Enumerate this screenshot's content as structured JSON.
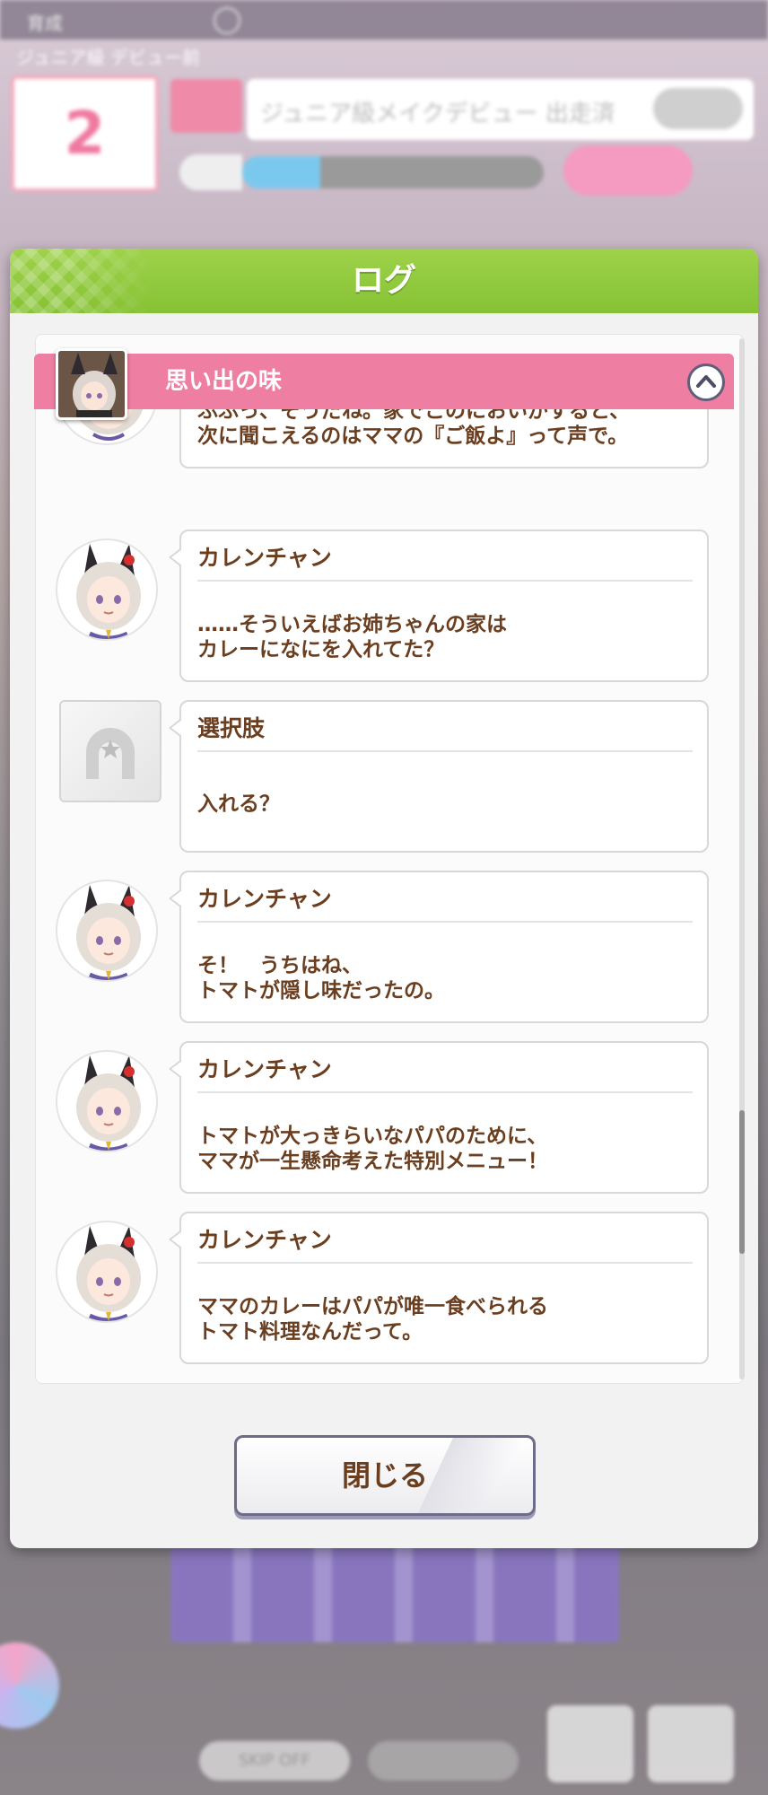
{
  "background": {
    "top_label": "育成",
    "subtitle": "ジュニア級 デビュー前",
    "turn_number": "2",
    "goal_text": "ジュニア級メイクデビュー 出走済",
    "stamina_fraction": 0.26,
    "skip_label": "SKIP OFF"
  },
  "dialog": {
    "title": "ログ",
    "chapter_title": "思い出の味",
    "close_label": "閉じる",
    "scroll_position_fraction": 0.86
  },
  "entries": [
    {
      "kind": "partial",
      "speaker": "",
      "text": "ふふっ、そうだね。家でこのにおいがすると、\n次に聞こえるのはママの『ご飯よ』って声で。"
    },
    {
      "kind": "character",
      "speaker": "カレンチャン",
      "text": "……そういえばお姉ちゃんの家は\nカレーになにを入れてた？"
    },
    {
      "kind": "choice",
      "speaker": "選択肢",
      "text": "入れる？"
    },
    {
      "kind": "character",
      "speaker": "カレンチャン",
      "text": "そ！　うちはね、\nトマトが隠し味だったの。"
    },
    {
      "kind": "character",
      "speaker": "カレンチャン",
      "text": "トマトが大っきらいなパパのために、\nママが一生懸命考えた特別メニュー！"
    },
    {
      "kind": "character",
      "speaker": "カレンチャン",
      "text": "ママのカレーはパパが唯一食べられる\nトマト料理なんだって。"
    }
  ],
  "icons": {
    "collapse": "chevron-up-icon",
    "choice": "horseshoe-icon",
    "avatar": "character-portrait-icon"
  },
  "colors": {
    "header_green": "#8cc63e",
    "chapter_pink": "#ee7ea2",
    "text_brown": "#6a3e1f"
  }
}
